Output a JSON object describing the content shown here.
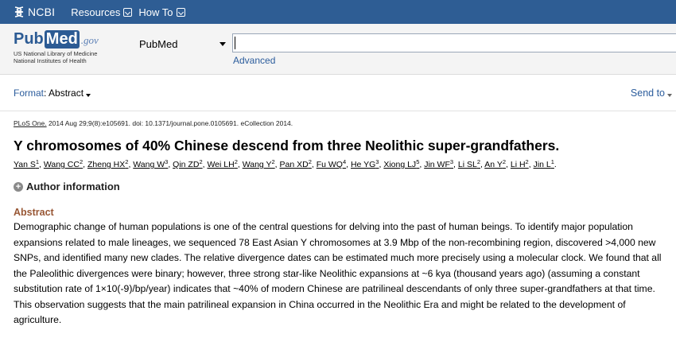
{
  "ncbi_bar": {
    "logo_text": "NCBI",
    "nav": [
      {
        "label": "Resources"
      },
      {
        "label": "How To"
      }
    ],
    "background": "#2e5d94"
  },
  "search": {
    "logo": {
      "pub": "Pub",
      "med": "Med",
      "gov": ".gov",
      "line1": "US National Library of Medicine",
      "line2": "National Institutes of Health"
    },
    "database": "PubMed",
    "query": "",
    "advanced_label": "Advanced"
  },
  "format_bar": {
    "format_label": "Format",
    "format_value": "Abstract",
    "send_to": "Send to"
  },
  "article": {
    "journal": "PLoS One.",
    "citation_rest": " 2014 Aug 29;9(8):e105691. doi: 10.1371/journal.pone.0105691. eCollection 2014.",
    "title": "Y chromosomes of 40% Chinese descend from three Neolithic super-grandfathers.",
    "authors": [
      {
        "name": "Yan S",
        "aff": "1"
      },
      {
        "name": "Wang CC",
        "aff": "2"
      },
      {
        "name": "Zheng HX",
        "aff": "2"
      },
      {
        "name": "Wang W",
        "aff": "3"
      },
      {
        "name": "Qin ZD",
        "aff": "2"
      },
      {
        "name": "Wei LH",
        "aff": "2"
      },
      {
        "name": "Wang Y",
        "aff": "2"
      },
      {
        "name": "Pan XD",
        "aff": "2"
      },
      {
        "name": "Fu WQ",
        "aff": "4"
      },
      {
        "name": "He YG",
        "aff": "3"
      },
      {
        "name": "Xiong LJ",
        "aff": "5"
      },
      {
        "name": "Jin WF",
        "aff": "3"
      },
      {
        "name": "Li SL",
        "aff": "2"
      },
      {
        "name": "An Y",
        "aff": "2"
      },
      {
        "name": "Li H",
        "aff": "2"
      },
      {
        "name": "Jin L",
        "aff": "1"
      }
    ],
    "author_info_label": "Author information",
    "abstract_heading": "Abstract",
    "abstract_text": "Demographic change of human populations is one of the central questions for delving into the past of human beings. To identify major population expansions related to male lineages, we sequenced 78 East Asian Y chromosomes at 3.9 Mbp of the non-recombining region, discovered >4,000 new SNPs, and identified many new clades. The relative divergence dates can be estimated much more precisely using a molecular clock. We found that all the Paleolithic divergences were binary; however, three strong star-like Neolithic expansions at ~6 kya (thousand years ago) (assuming a constant substitution rate of 1×10(-9)/bp/year) indicates that ~40% of modern Chinese are patrilineal descendants of only three super-grandfathers at that time. This observation suggests that the main patrilineal expansion in China occurred in the Neolithic Era and might be related to the development of agriculture."
  },
  "colors": {
    "link": "#2b5c9c",
    "abstract_heading": "#985735"
  }
}
